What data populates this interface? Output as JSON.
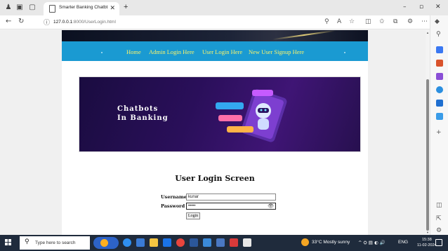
{
  "browser": {
    "tab_title": "Smarter Banking Chatbt",
    "url_host": "127.0.0.1",
    "url_rest": ":8000/UserLogin.html"
  },
  "nav": {
    "home": "Home",
    "admin_login": "Admin Login Here",
    "user_login": "User Login Here",
    "signup": "New User Signup Here"
  },
  "banner": {
    "line1": "Chatbots",
    "line2": "In Banking"
  },
  "login": {
    "heading": "User Login Screen",
    "username_label": "Username",
    "username_value": "kunar",
    "password_label": "Password",
    "password_value": "•••••",
    "submit_label": "Login"
  },
  "taskbar": {
    "search_placeholder": "Type here to search",
    "weather": "33°C  Mostly sunny",
    "language": "ENG",
    "time": "15:38",
    "date": "11-02-2024"
  },
  "colors": {
    "nav_band": "#1a9ad2",
    "nav_link": "#fbf46a",
    "banner_bg": "#2a0f5a",
    "taskbar_bg": "#1f2b3c"
  }
}
